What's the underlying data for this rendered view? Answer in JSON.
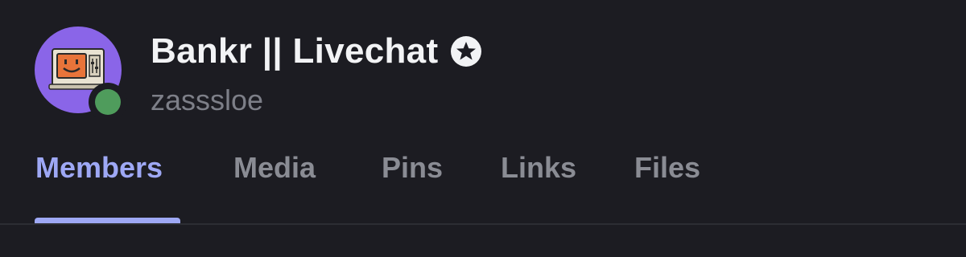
{
  "channel": {
    "title": "Bankr || Livechat",
    "verified_icon": "star-badge-icon",
    "subtitle": "zasssloe",
    "avatar_icon": "retro-computer-smiley-icon",
    "status": "online"
  },
  "tabs": [
    {
      "label": "Members",
      "active": true
    },
    {
      "label": "Media",
      "active": false
    },
    {
      "label": "Pins",
      "active": false
    },
    {
      "label": "Links",
      "active": false
    },
    {
      "label": "Files",
      "active": false
    }
  ],
  "colors": {
    "background": "#1c1c22",
    "avatar_bg": "#8a65e8",
    "online": "#4f9c5c",
    "accent": "#9ea8f5",
    "muted_text": "#8a8c94"
  }
}
